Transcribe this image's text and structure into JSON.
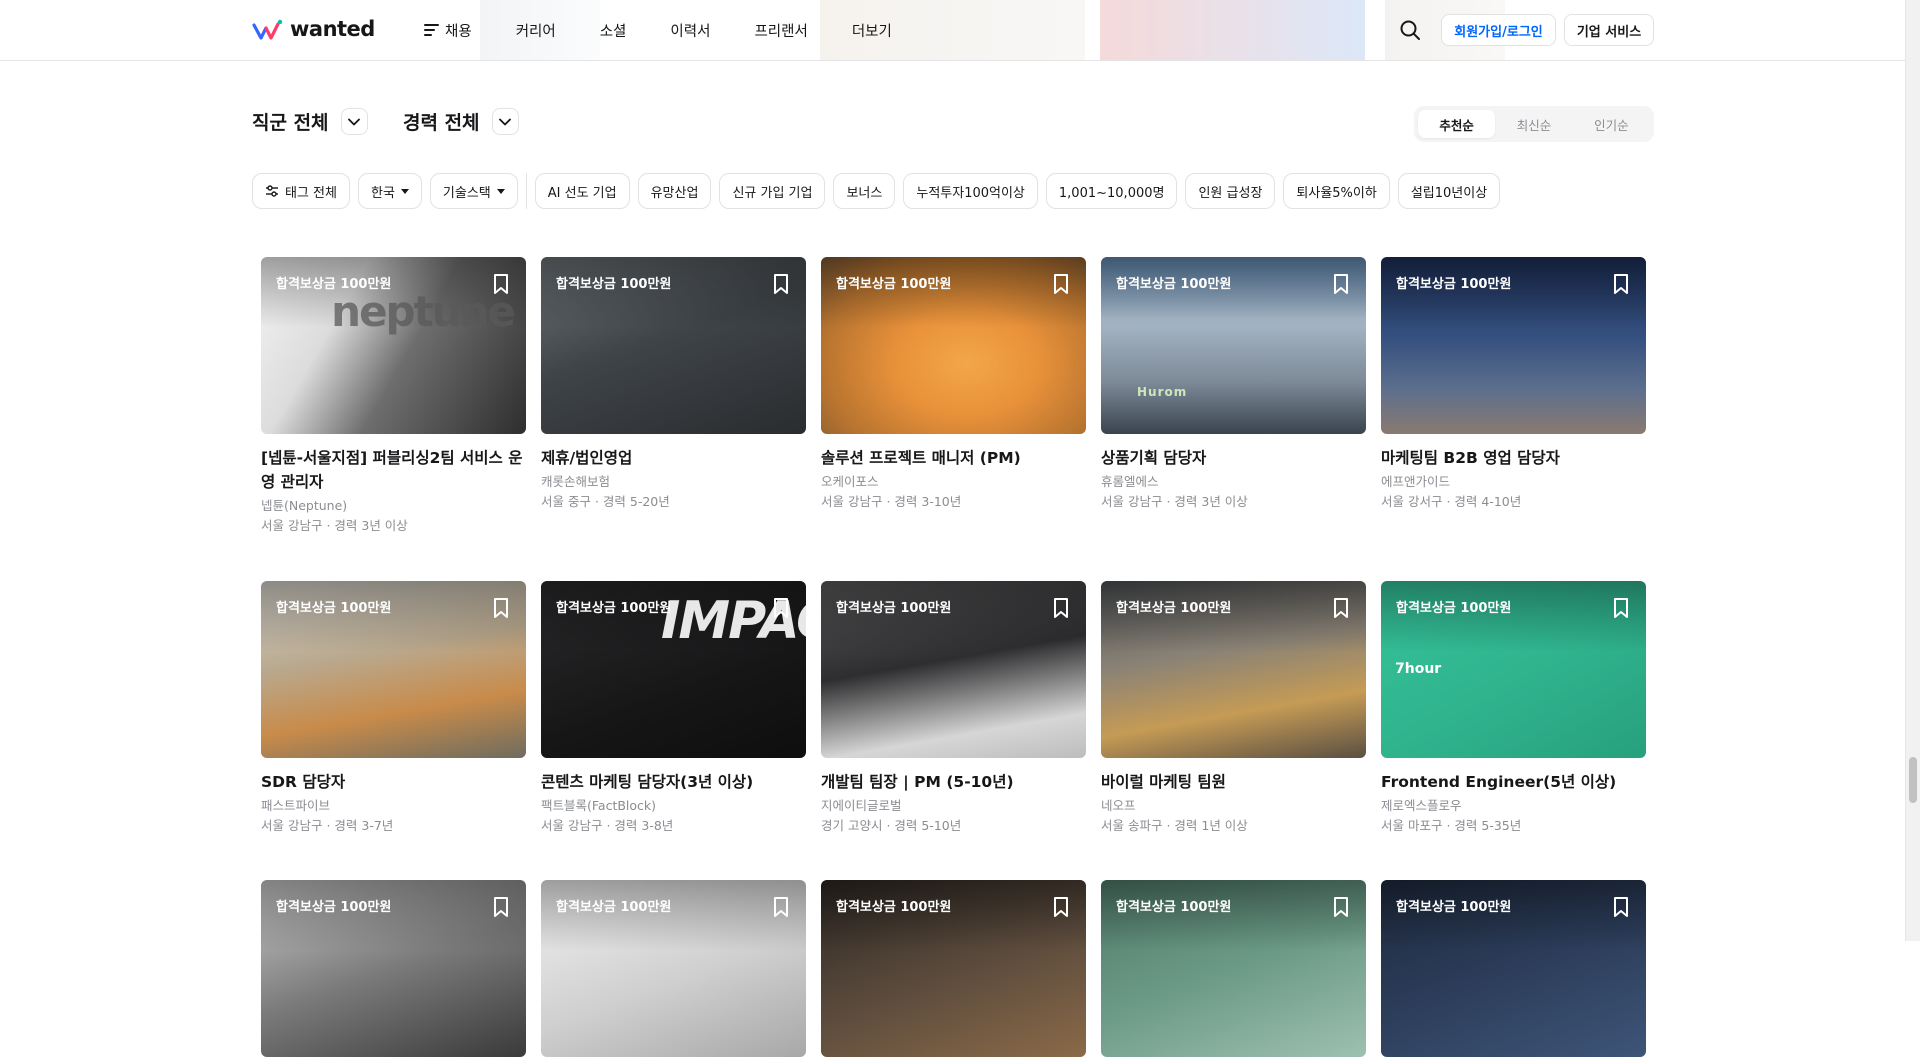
{
  "header": {
    "logo_text": "wanted",
    "nav": [
      "채용",
      "커리어",
      "소셜",
      "이력서",
      "프리랜서",
      "더보기"
    ],
    "signup_label": "회원가입/로그인",
    "biz_label": "기업 서비스"
  },
  "filters": {
    "job_category": "직군 전체",
    "experience": "경력 전체"
  },
  "sort": {
    "options": [
      "추천순",
      "최신순",
      "인기순"
    ],
    "active": "추천순"
  },
  "tags": {
    "all": "태그 전체",
    "country": "한국",
    "tech": "기술스택",
    "items": [
      "AI 선도 기업",
      "유망산업",
      "신규 가입 기업",
      "보너스",
      "누적투자100억이상",
      "1,001~10,000명",
      "인원 급성장",
      "퇴사율5%이하",
      "설립10년이상"
    ]
  },
  "cards": [
    {
      "reward": "합격보상금 100만원",
      "title": "[넵튠-서울지점] 퍼블리싱2팀 서비스 운영 관리자",
      "company": "넵튠(Neptune)",
      "meta": "서울 강남구 · 경력 3년 이상",
      "overlay": "neptune"
    },
    {
      "reward": "합격보상금 100만원",
      "title": "제휴/법인영업",
      "company": "캐롯손해보험",
      "meta": "서울 중구 · 경력 5-20년",
      "overlay": ""
    },
    {
      "reward": "합격보상금 100만원",
      "title": "솔루션 프로젝트 매니저 (PM)",
      "company": "오케이포스",
      "meta": "서울 강남구 · 경력 3-10년",
      "overlay": ""
    },
    {
      "reward": "합격보상금 100만원",
      "title": "상품기획 담당자",
      "company": "휴롬엘에스",
      "meta": "서울 강남구 · 경력 3년 이상",
      "overlay": "Hurom"
    },
    {
      "reward": "합격보상금 100만원",
      "title": "마케팅팀 B2B 영업 담당자",
      "company": "에프앤가이드",
      "meta": "서울 강서구 · 경력 4-10년",
      "overlay": ""
    },
    {
      "reward": "합격보상금 100만원",
      "title": "SDR 담당자",
      "company": "패스트파이브",
      "meta": "서울 강남구 · 경력 3-7년",
      "overlay": ""
    },
    {
      "reward": "합격보상금 100만원",
      "title": "콘텐츠 마케팅 담당자(3년 이상)",
      "company": "팩트블록(FactBlock)",
      "meta": "서울 강남구 · 경력 3-8년",
      "overlay": "IMPACT"
    },
    {
      "reward": "합격보상금 100만원",
      "title": "개발팀 팀장 | PM (5-10년)",
      "company": "지에이티글로벌",
      "meta": "경기 고양시 · 경력 5-10년",
      "overlay": ""
    },
    {
      "reward": "합격보상금 100만원",
      "title": "바이럴 마케팅 팀원",
      "company": "네오프",
      "meta": "서울 송파구 · 경력 1년 이상",
      "overlay": ""
    },
    {
      "reward": "합격보상금 100만원",
      "title": "Frontend Engineer(5년 이상)",
      "company": "제로엑스플로우",
      "meta": "서울 마포구 · 경력 5-35년",
      "overlay": "7hour"
    },
    {
      "reward": "합격보상금 100만원",
      "title": "",
      "company": "",
      "meta": "",
      "overlay": ""
    },
    {
      "reward": "합격보상금 100만원",
      "title": "",
      "company": "",
      "meta": "",
      "overlay": ""
    },
    {
      "reward": "합격보상금 100만원",
      "title": "",
      "company": "",
      "meta": "",
      "overlay": ""
    },
    {
      "reward": "합격보상금 100만원",
      "title": "",
      "company": "",
      "meta": "",
      "overlay": ""
    },
    {
      "reward": "합격보상금 100만원",
      "title": "",
      "company": "",
      "meta": "",
      "overlay": ""
    }
  ],
  "colors": {
    "brand": "#0066ff",
    "text": "#171719",
    "muted": "#8b8d92",
    "border": "#e1e2e4"
  }
}
